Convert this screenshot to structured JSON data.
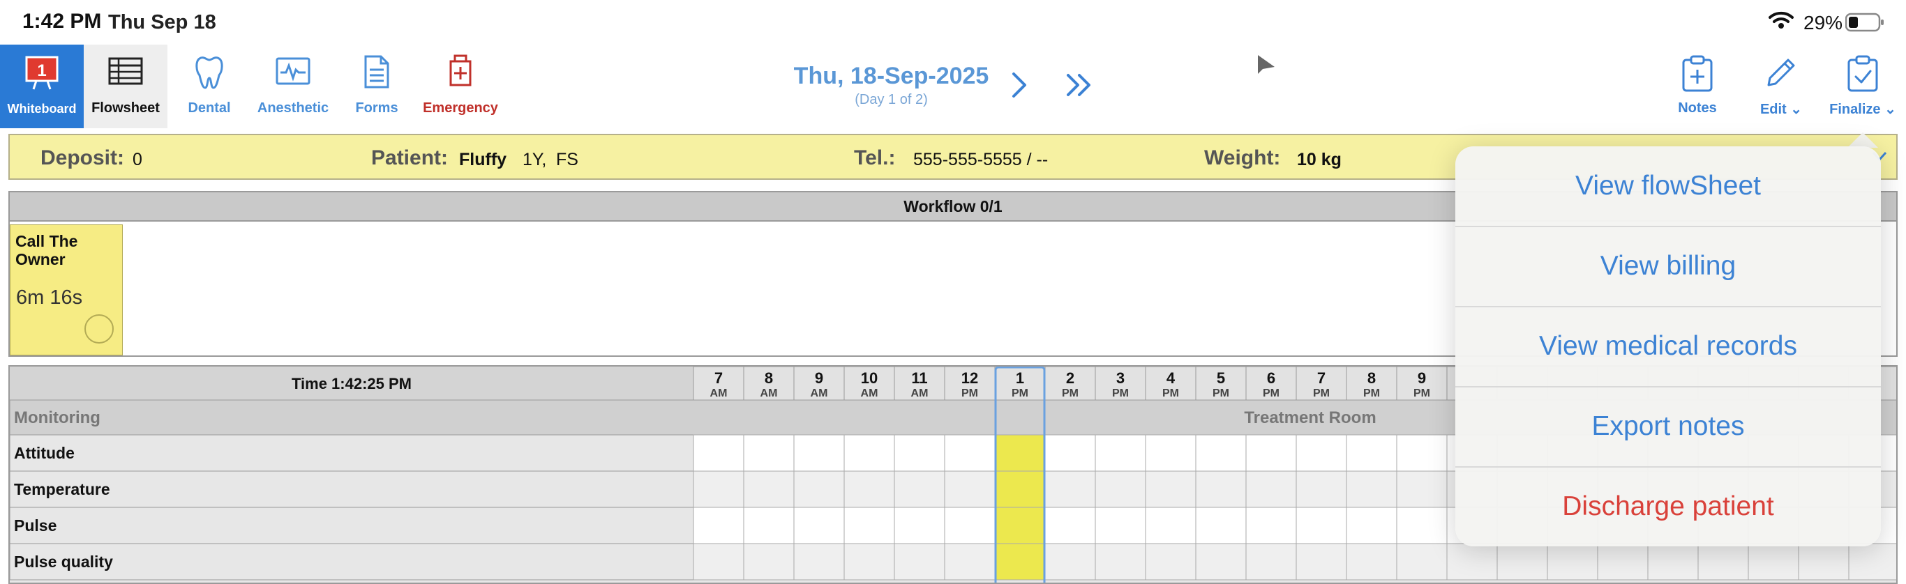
{
  "status_bar": {
    "time": "1:42 PM",
    "date": "Thu Sep 18",
    "battery": "29%"
  },
  "toolbar": {
    "whiteboard": {
      "label": "Whiteboard",
      "badge": "1"
    },
    "flowsheet": {
      "label": "Flowsheet"
    },
    "dental": {
      "label": "Dental"
    },
    "anesthetic": {
      "label": "Anesthetic"
    },
    "forms": {
      "label": "Forms"
    },
    "emergency": {
      "label": "Emergency"
    },
    "notes": {
      "label": "Notes"
    },
    "edit": {
      "label": "Edit"
    },
    "finalize": {
      "label": "Finalize"
    }
  },
  "date_nav": {
    "title": "Thu, 18-Sep-2025",
    "subtitle": "(Day 1 of 2)"
  },
  "patient_bar": {
    "deposit_label": "Deposit:",
    "deposit_value": "0",
    "patient_label": "Patient:",
    "patient_name": "Fluffy",
    "patient_age": "1Y,",
    "patient_sex": "FS",
    "tel_label": "Tel.:",
    "tel_value": "555-555-5555 / --",
    "weight_label": "Weight:",
    "weight_value": "10 kg"
  },
  "workflow": {
    "header": "Workflow 0/1",
    "task": {
      "title": "Call The Owner",
      "timer": "6m 16s"
    }
  },
  "grid": {
    "time_label": "Time 1:42:25 PM",
    "hours": [
      {
        "h": "7",
        "p": "AM"
      },
      {
        "h": "8",
        "p": "AM"
      },
      {
        "h": "9",
        "p": "AM"
      },
      {
        "h": "10",
        "p": "AM"
      },
      {
        "h": "11",
        "p": "AM"
      },
      {
        "h": "12",
        "p": "PM"
      },
      {
        "h": "1",
        "p": "PM"
      },
      {
        "h": "2",
        "p": "PM"
      },
      {
        "h": "3",
        "p": "PM"
      },
      {
        "h": "4",
        "p": "PM"
      },
      {
        "h": "5",
        "p": "PM"
      },
      {
        "h": "6",
        "p": "PM"
      },
      {
        "h": "7",
        "p": "PM"
      },
      {
        "h": "8",
        "p": "PM"
      },
      {
        "h": "9",
        "p": "PM"
      },
      {
        "h": "",
        "p": ""
      },
      {
        "h": "",
        "p": ""
      },
      {
        "h": "",
        "p": ""
      },
      {
        "h": "",
        "p": ""
      },
      {
        "h": "",
        "p": ""
      },
      {
        "h": "",
        "p": ""
      },
      {
        "h": "",
        "p": ""
      },
      {
        "h": "",
        "p": ""
      },
      {
        "h": "",
        "p": ""
      }
    ],
    "current_hour_index": 6,
    "section_label": "Monitoring",
    "location_label": "Treatment Room",
    "rows": [
      "Attitude",
      "Temperature",
      "Pulse",
      "Pulse quality"
    ]
  },
  "menu": {
    "items": [
      {
        "label": "View flowSheet",
        "color": "#3c82d4"
      },
      {
        "label": "View billing",
        "color": "#3c82d4"
      },
      {
        "label": "View medical records",
        "color": "#3c82d4"
      },
      {
        "label": "Export notes",
        "color": "#3c82d4"
      },
      {
        "label": "Discharge patient",
        "color": "#d9413a"
      }
    ]
  },
  "colors": {
    "accent": "#3c82d4",
    "highlight": "#ece84e",
    "patient_bar": "#f6f1a2",
    "danger": "#c0302a"
  }
}
